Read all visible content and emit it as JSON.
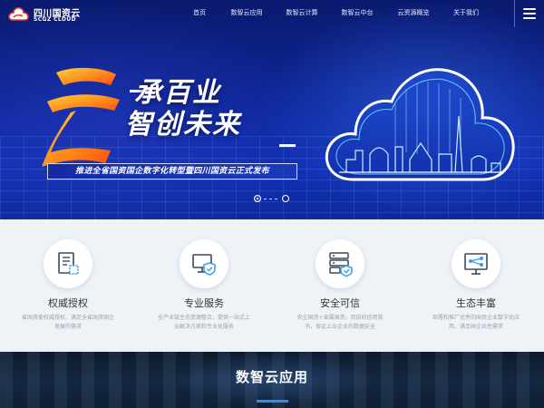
{
  "brand": {
    "name_cn": "四川国资云",
    "name_en": "SCGZ CLOUD"
  },
  "nav": {
    "items": [
      {
        "label": "首页"
      },
      {
        "label": "数智云应用"
      },
      {
        "label": "数智云计算"
      },
      {
        "label": "数智云中台"
      },
      {
        "label": "云资源概览"
      },
      {
        "label": "关于我们"
      }
    ],
    "menu_icon": "hamburger-icon"
  },
  "hero": {
    "headline_line1": "承百业",
    "headline_line2": "智创未来",
    "tagline": "推进全省国资国企数字化转型暨四川国资云正式发布",
    "carousel": {
      "count": 2,
      "active": 0
    }
  },
  "features": [
    {
      "icon": "certificate-icon",
      "title": "权威授权",
      "desc": "省国资委权威授权，满足全省国资国企发展的需求"
    },
    {
      "icon": "monitor-shield-icon",
      "title": "专业服务",
      "desc": "全产业链生态资源整合，提供一站式上云解决方案和专业化服务"
    },
    {
      "icon": "server-shield-icon",
      "title": "安全可信",
      "desc": "央企国资+省属国资，双倍的信用背书，保证上云企业的数据安全"
    },
    {
      "icon": "network-screen-icon",
      "title": "生态丰富",
      "desc": "部署和推广优秀的国资企业数字化应用，满足国企共性需求"
    }
  ],
  "apps_section": {
    "title": "数智云应用"
  },
  "colors": {
    "hero_bg": "#0d2596",
    "accent_blue": "#2f8df0",
    "feature_bg": "#eef3f8",
    "logo_red": "#e03a3a"
  }
}
